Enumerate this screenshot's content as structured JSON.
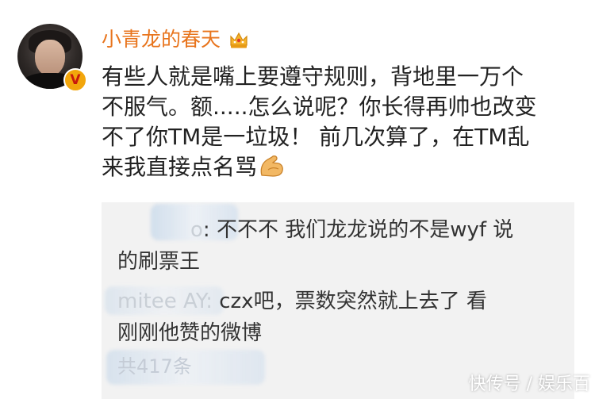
{
  "post": {
    "username": "小青龙的春天",
    "verified_badge": "V",
    "lines": [
      "有些人就是嘴上要遵守规则，背地里一万个",
      "不服气。额.....怎么说呢？你长得再帅也改变",
      "不了你TM是一垃圾！ 前几次算了，在TM乱",
      "来我直接点名骂"
    ]
  },
  "replies": [
    {
      "name": "o",
      "text": ": 不不不  我们龙龙说的不是wyf  说",
      "continuation": "的刷票王"
    },
    {
      "name": "mitee AY:",
      "text": " czx吧，票数突然就上去了 看",
      "continuation": "刚刚他赞的微博"
    }
  ],
  "more_replies": "共417条",
  "watermark": "快传号 / 娱乐百",
  "icons": {
    "crown": "crown-icon",
    "arm": "flexed-arm-icon"
  },
  "colors": {
    "username": "#e8741c",
    "body_text": "#222222",
    "reply_bg": "#f2f2f2"
  }
}
